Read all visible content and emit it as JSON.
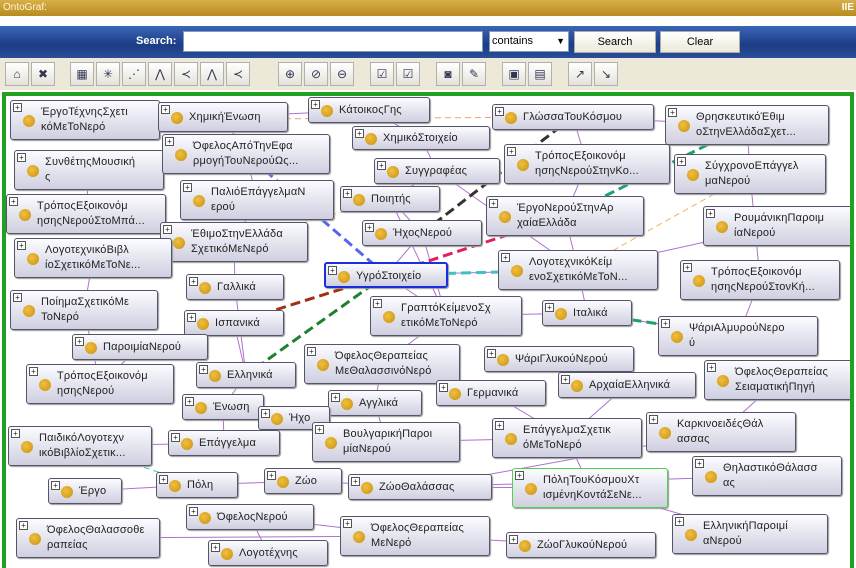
{
  "window": {
    "title": "OntoGraf:",
    "corner": "IIE"
  },
  "search": {
    "label": "Search:",
    "value": "",
    "mode": "contains",
    "search_button": "Search",
    "clear_button": "Clear"
  },
  "toolbar": {
    "icons": [
      "home-icon",
      "remove-icon",
      "grid-layout-icon",
      "radial-layout-icon",
      "spring-layout-icon",
      "tree-vertical-icon",
      "tree-horizontal-icon",
      "tree-vertical-alt-icon",
      "tree-horizontal-alt-icon",
      "zoom-in-icon",
      "zoom-reset-icon",
      "zoom-out-icon",
      "filter-nodes-icon",
      "filter-arcs-icon",
      "camera-icon",
      "edit-icon",
      "save-icon",
      "open-folder-icon",
      "export-icon",
      "import-icon"
    ]
  },
  "colors": {
    "accent": "#22a020",
    "selected": "#1a2ee0",
    "title": "#c89a30"
  },
  "graph": {
    "selected": "ΥγρόΣτοιχείο",
    "nodes": [
      [
        "ΈργοΤέχνηςΣχετι",
        "κόΜεΤοΝερό"
      ],
      [
        "ΧημικήΈνωση"
      ],
      [
        "ΚάτοικοςΓης"
      ],
      [
        "ΓλώσσαΤουΚόσμου"
      ],
      [
        "ΘρησκευτικόΈθιμ",
        "οΣτηνΕλλάδαΣχετ..."
      ],
      [
        "ΧημικόΣτοιχείο"
      ],
      [
        "ΣυνθέτηςΜουσική",
        "ς"
      ],
      [
        "ΌφελοςΑπόΤηνΕφα",
        "ρμογήΤουΝερούΩς..."
      ],
      [
        "ΤρόποςΕξοικονόμ",
        "ησηςΝερούΣτηνΚο..."
      ],
      [
        "ΣύγχρονοΕπάγγελ",
        "μαΝερού"
      ],
      [
        "Συγγραφέας"
      ],
      [
        "ΠαλιόΕπάγγελμαΝ",
        "ερού"
      ],
      [
        "Ποιητής"
      ],
      [
        "ΤρόποςΕξοικονόμ",
        "ησηςΝερούΣτοΜπά..."
      ],
      [
        "ΈργοΝερούΣτηνΑρ",
        "χαίαΕλλάδα"
      ],
      [
        "ΡουμάνικηΠαροιμ",
        "ίαΝερού"
      ],
      [
        "ΉχοςΝερού"
      ],
      [
        "ΈθιμοΣτηνΕλλάδα",
        "ΣχετικόΜεΝερό"
      ],
      [
        "ΛογοτεχνικόΒιβλ",
        "ίοΣχετικόΜεΤοΝε..."
      ],
      [
        "ΥγρόΣτοιχείο"
      ],
      [
        "ΛογοτεχνικόΚείμ",
        "ενοΣχετικόΜεΤοΝ..."
      ],
      [
        "ΤρόποςΕξοικονόμ",
        "ησηςΝερούΣτονΚή..."
      ],
      [
        "Γαλλικά"
      ],
      [
        "ΠοίημαΣχετικόΜε",
        "ΤοΝερό"
      ],
      [
        "ΓραπτόΚείμενοΣχ",
        "ετικόΜεΤοΝερό"
      ],
      [
        "Ιταλικά"
      ],
      [
        "Ισπανικά"
      ],
      [
        "ΨάριΑλμυρούΝερο",
        "ύ"
      ],
      [
        "ΠαροιμίαΝερού"
      ],
      [
        "ΌφελοςΘεραπείας",
        "ΜεΘαλασσινόΝερό"
      ],
      [
        "ΨάριΓλυκούΝερού"
      ],
      [
        "ΤρόποςΕξοικονόμ",
        "ησηςΝερού"
      ],
      [
        "Ελληνικά"
      ],
      [
        "ΌφελοςΘεραπείας",
        "ΣειαματικήΠηγή"
      ],
      [
        "ΑρχαίαΕλληνικά"
      ],
      [
        "Γερμανικά"
      ],
      [
        "Αγγλικά"
      ],
      [
        "Ένωση"
      ],
      [
        "Ήχο"
      ],
      [
        "ΚαρκινοειδέςΘάλ",
        "ασσας"
      ],
      [
        "ΠαιδικόΛογοτεχν",
        "ικόΒιβλίοΣχετικ..."
      ],
      [
        "Επάγγελμα"
      ],
      [
        "ΒουλγαρικήΠαροι",
        "μίαΝερού"
      ],
      [
        "ΕπάγγελμαΣχετικ",
        "όΜεΤοΝερό"
      ],
      [
        "ΘηλαστικόΘάλασσ",
        "ας"
      ],
      [
        "Πόλη"
      ],
      [
        "Ζώο"
      ],
      [
        "ΖώοΘαλάσσας"
      ],
      [
        "ΠόληΤουΚόσμουΧτ",
        "ισμένηΚοντάΣεΝε..."
      ],
      [
        "Έργο"
      ],
      [
        "ΌφελοςΝερού"
      ],
      [
        "ΌφελοςΘαλασσοθε",
        "ραπείας"
      ],
      [
        "ΌφελοςΘεραπείας",
        "ΜεΝερό"
      ],
      [
        "ΕλληνικήΠαροιμί",
        "αΝερού"
      ],
      [
        "ΖώοΓλυκούΝερού"
      ],
      [
        "Λογοτέχνης"
      ]
    ]
  }
}
